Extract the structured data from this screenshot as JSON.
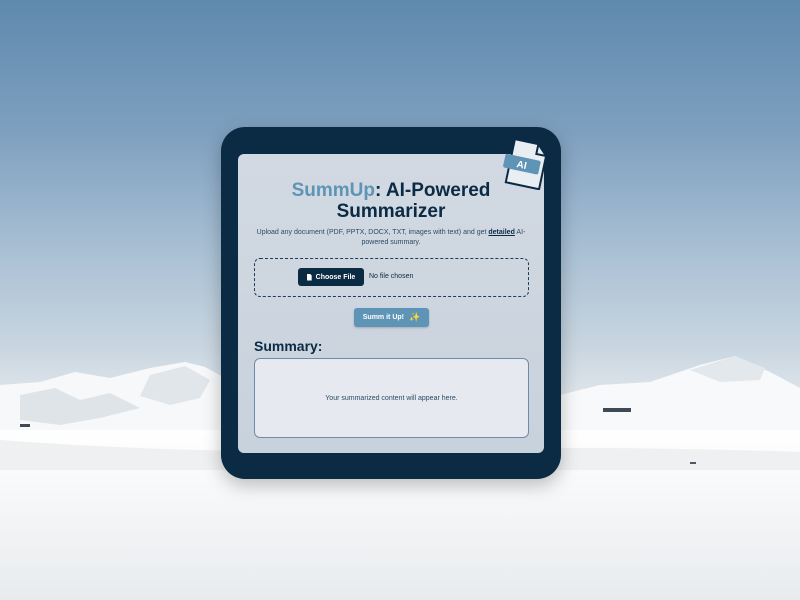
{
  "app": {
    "title_brand": "SummUp",
    "title_rest": ": AI-Powered Summarizer",
    "subtitle_before": "Upload any document (PDF, PPTX, DOCX, TXT, images with text) and get ",
    "subtitle_strong": "detailed",
    "subtitle_after": " AI-powered summary."
  },
  "upload": {
    "choose_label": "Choose File",
    "status": "No file chosen"
  },
  "actions": {
    "submit_label": "Summ it Up!"
  },
  "summary": {
    "heading": "Summary:",
    "placeholder": "Your summarized content will appear here."
  },
  "badge": {
    "text": "AI"
  },
  "colors": {
    "navy": "#0b2a44",
    "accent": "#5e94b5",
    "panel": "#d2d9e3"
  }
}
